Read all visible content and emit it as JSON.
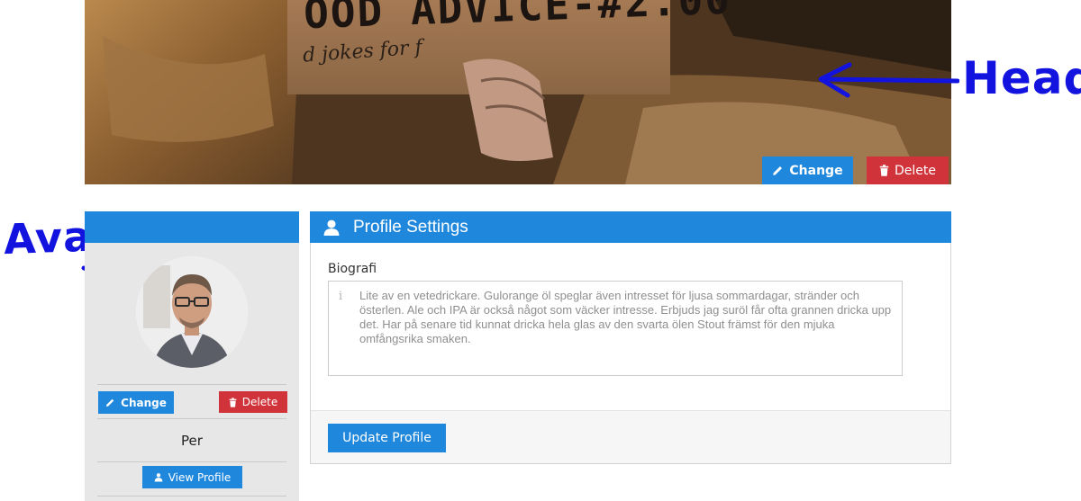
{
  "header": {
    "sign_text": "OOD ADVICE-#2.00",
    "sign_subtext": "d jokes for f",
    "change_label": "Change",
    "delete_label": "Delete"
  },
  "annotations": {
    "head": "Head",
    "avatar": "Avatar"
  },
  "avatar_panel": {
    "change_label": "Change",
    "delete_label": "Delete",
    "name": "Per",
    "view_profile_label": "View Profile"
  },
  "settings": {
    "title": "Profile Settings",
    "biography_label": "Biografi",
    "biography_text": "Lite av en vetedrickare. Gulorange öl speglar även intresset för ljusa sommardagar, stränder och österlen. Ale och IPA är också något som väcker intresse. Erbjuds jag suröl får ofta grannen dricka upp det. Har på senare tid kunnat dricka hela glas av den svarta ölen Stout främst för den mjuka omfångsrika smaken.",
    "update_label": "Update Profile"
  },
  "colors": {
    "primary": "#2088dc",
    "danger": "#d0343a",
    "annotation": "#1313e0",
    "panel_bg": "#e7e7e7"
  },
  "icons": [
    "pencil-icon",
    "trash-icon",
    "user-icon",
    "info-icon"
  ]
}
